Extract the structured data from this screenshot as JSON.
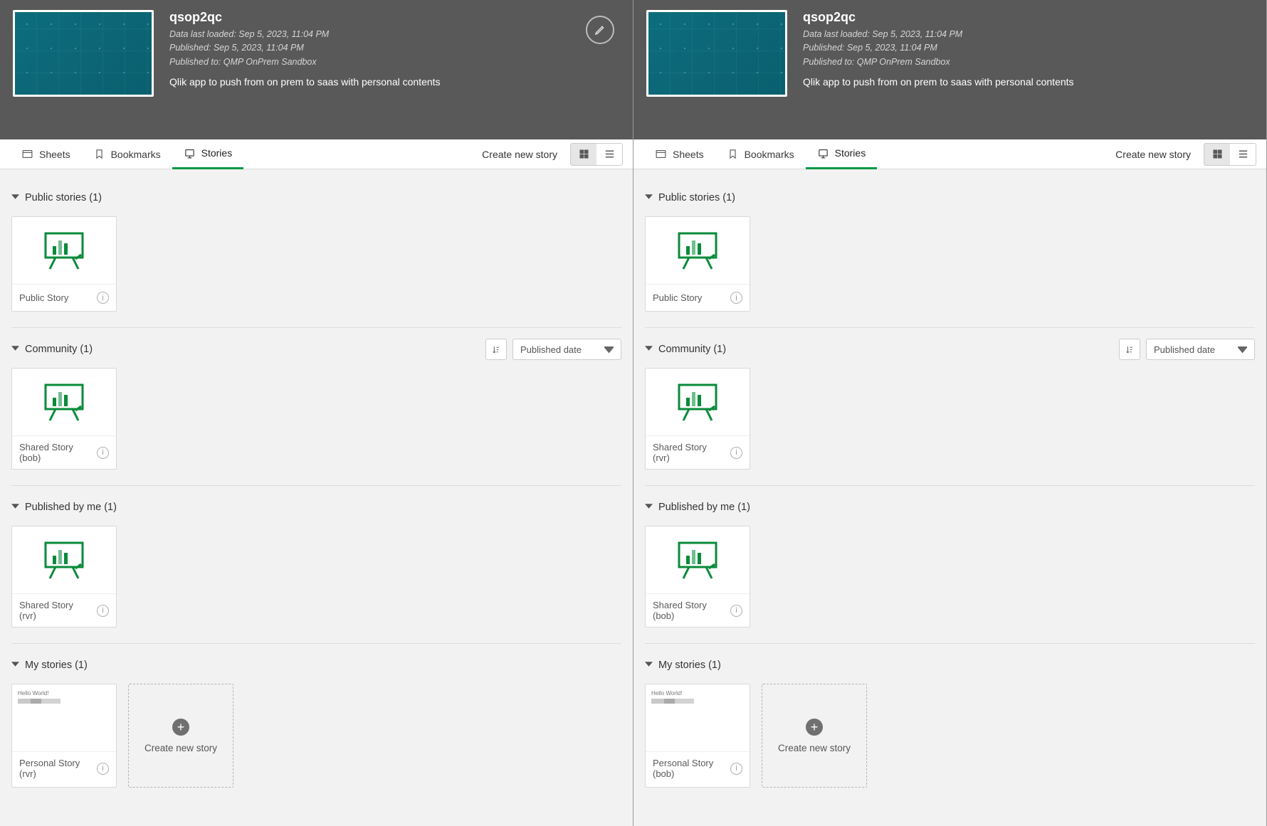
{
  "app": {
    "title": "qsop2qc",
    "meta1": "Data last loaded: Sep 5, 2023, 11:04 PM",
    "meta2": "Published: Sep 5, 2023, 11:04 PM",
    "meta3": "Published to: QMP OnPrem Sandbox",
    "desc": "Qlik app to push from on prem to saas with personal contents"
  },
  "tabs": {
    "sheets": "Sheets",
    "bookmarks": "Bookmarks",
    "stories": "Stories",
    "create_new_story": "Create new story"
  },
  "sort": {
    "published_date": "Published date"
  },
  "left": {
    "public": {
      "header": "Public stories (1)",
      "item": "Public Story"
    },
    "community": {
      "header": "Community (1)",
      "item": "Shared Story (bob)"
    },
    "pubbyme": {
      "header": "Published by me (1)",
      "item": "Shared Story (rvr)"
    },
    "mine": {
      "header": "My stories (1)",
      "item": "Personal Story (rvr)"
    }
  },
  "right": {
    "public": {
      "header": "Public stories (1)",
      "item": "Public Story"
    },
    "community": {
      "header": "Community (1)",
      "item": "Shared Story (rvr)"
    },
    "pubbyme": {
      "header": "Published by me (1)",
      "item": "Shared Story (bob)"
    },
    "mine": {
      "header": "My stories (1)",
      "item": "Personal Story (bob)"
    }
  },
  "create_card": "Create new story",
  "hello": "Hello World!"
}
